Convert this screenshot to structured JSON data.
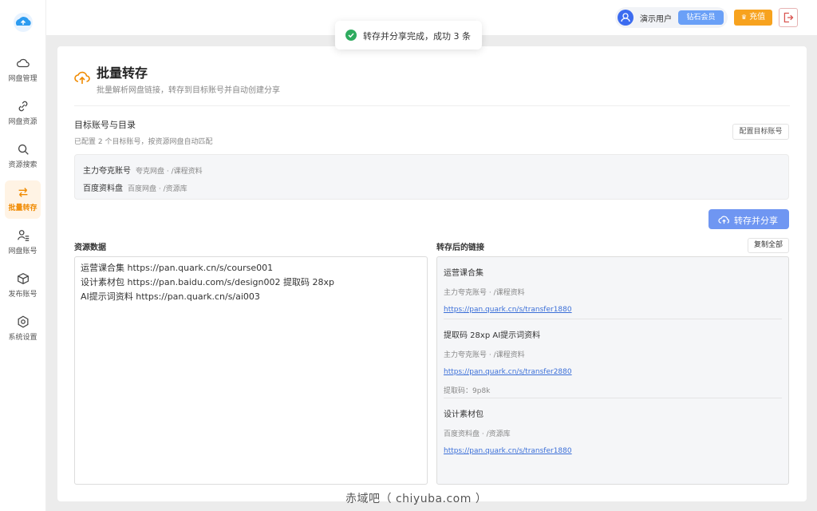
{
  "nav": [
    {
      "label": "网盘管理",
      "icon": "cloud-icon"
    },
    {
      "label": "网盘资源",
      "icon": "link-icon"
    },
    {
      "label": "资源搜索",
      "icon": "search-icon"
    },
    {
      "label": "批量转存",
      "icon": "transfer-icon",
      "active": true
    },
    {
      "label": "网盘账号",
      "icon": "user-list-icon"
    },
    {
      "label": "发布账号",
      "icon": "box-icon"
    },
    {
      "label": "系统设置",
      "icon": "gear-icon"
    }
  ],
  "topbar": {
    "user_name": "演示用户",
    "vip_label": "钻石会员",
    "recharge_label": "充值"
  },
  "toast": {
    "message": "转存并分享完成，成功 3 条"
  },
  "page": {
    "title": "批量转存",
    "subtitle": "批量解析网盘链接，转存到目标账号并自动创建分享"
  },
  "target": {
    "title": "目标账号与目录",
    "desc": "已配置 2 个目标账号，按资源网盘自动匹配",
    "config_button": "配置目标账号",
    "accounts": [
      {
        "name": "主力夸克账号",
        "path": "夸克网盘 · /课程资料"
      },
      {
        "name": "百度资料盘",
        "path": "百度网盘 · /资源库"
      }
    ]
  },
  "share_button": "转存并分享",
  "source": {
    "label": "资源数据",
    "lines": [
      "运营课合集 https://pan.quark.cn/s/course001",
      "设计素材包 https://pan.baidu.com/s/design002 提取码 28xp",
      "AI提示词资料 https://pan.quark.cn/s/ai003"
    ]
  },
  "result": {
    "label": "转存后的链接",
    "copy_all": "复制全部",
    "items": [
      {
        "title": "运营课合集",
        "path": "主力夸克账号 · /课程资料",
        "link": "https://pan.quark.cn/s/transfer1880"
      },
      {
        "title": "提取码 28xp AI提示词资料",
        "path": "主力夸克账号 · /课程资料",
        "link": "https://pan.quark.cn/s/transfer2880",
        "code": "提取码：9p8k"
      },
      {
        "title": "设计素材包",
        "path": "百度资料盘 · /资源库",
        "link": "https://pan.quark.cn/s/transfer1880"
      }
    ]
  },
  "watermark": "赤域吧（ chiyuba.com ）",
  "colors": {
    "accent": "#f08a00",
    "primary": "#6f96f2",
    "link": "#3b6fd8",
    "success": "#2eab5f"
  }
}
